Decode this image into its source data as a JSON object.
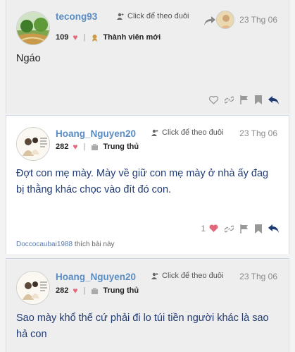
{
  "posts": [
    {
      "username": "tecong93",
      "follow_label": "Click để theo đuôi",
      "date": "23 Thg 06",
      "likes_count": "109",
      "title": "Thành viên mới",
      "body": "Ngáo",
      "action_like_count": ""
    },
    {
      "username": "Hoang_Nguyen20",
      "follow_label": "Click để theo đuôi",
      "date": "23 Thg 06",
      "likes_count": "282",
      "title": "Trung thủ",
      "body": "Đợt con mẹ mày. Mày về giữ con mẹ mày ở nhà ấy đag bị thằng khác chọc vào đít đó con.",
      "action_like_count": "1",
      "liked_by_user": "Doccocaubai1988",
      "liked_by_suffix": "thích bài này"
    },
    {
      "username": "Hoang_Nguyen20",
      "follow_label": "Click để theo đuôi",
      "date": "23 Thg 06",
      "likes_count": "282",
      "title": "Trung thủ",
      "body": "Sao mày khổ thế cứ phải đi lo túi tiền người khác là sao hả con"
    }
  ],
  "colors": {
    "accent": "#5a8cc4",
    "heart": "#e0677c",
    "body_text": "#1f3a73"
  },
  "icons": [
    "follow-user-icon",
    "heart-icon",
    "title-badge-icon",
    "share-icon",
    "link-icon",
    "flag-icon",
    "bookmark-icon",
    "reply-icon"
  ]
}
